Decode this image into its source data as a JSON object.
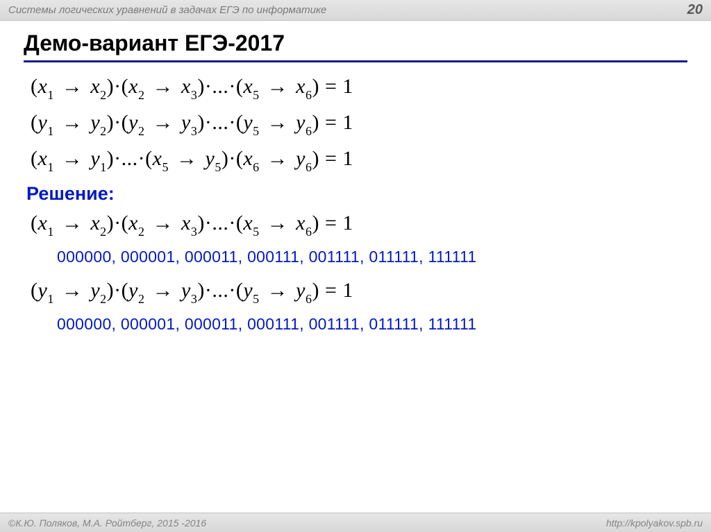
{
  "header": {
    "title": "Системы логических уравнений в задачах ЕГЭ по информатике",
    "page": "20"
  },
  "slide": {
    "title": "Демо-вариант ЕГЭ-2017"
  },
  "equations": {
    "eq1": {
      "t1v": "x",
      "t1s": "1",
      "t2v": "x",
      "t2s": "2",
      "t3v": "x",
      "t3s": "2",
      "t4v": "x",
      "t4s": "3",
      "t5v": "x",
      "t5s": "5",
      "t6v": "x",
      "t6s": "6",
      "dots": "...",
      "eq": " = 1"
    },
    "eq2": {
      "t1v": "y",
      "t1s": "1",
      "t2v": "y",
      "t2s": "2",
      "t3v": "y",
      "t3s": "2",
      "t4v": "y",
      "t4s": "3",
      "t5v": "y",
      "t5s": "5",
      "t6v": "y",
      "t6s": "6",
      "dots": "...",
      "eq": " = 1"
    },
    "eq3": {
      "t1v": "x",
      "t1s": "1",
      "t2v": "y",
      "t2s": "1",
      "t3v": "x",
      "t3s": "5",
      "t4v": "y",
      "t4s": "5",
      "t5v": "x",
      "t5s": "6",
      "t6v": "y",
      "t6s": "6",
      "dots": "...",
      "eq": " = 1"
    }
  },
  "solution": {
    "label": "Решение:",
    "sol_eq1": {
      "t1v": "x",
      "t1s": "1",
      "t2v": "x",
      "t2s": "2",
      "t3v": "x",
      "t3s": "2",
      "t4v": "x",
      "t4s": "3",
      "t5v": "x",
      "t5s": "5",
      "t6v": "x",
      "t6s": "6",
      "dots": "...",
      "eq": " = 1"
    },
    "bin1": "000000, 000001, 000011, 000111, 001111, 011111, 111111",
    "sol_eq2": {
      "t1v": "y",
      "t1s": "1",
      "t2v": "y",
      "t2s": "2",
      "t3v": "y",
      "t3s": "2",
      "t4v": "y",
      "t4s": "3",
      "t5v": "y",
      "t5s": "5",
      "t6v": "y",
      "t6s": "6",
      "dots": "...",
      "eq": " = 1"
    },
    "bin2": "000000, 000001, 000011, 000111, 001111, 011111, 111111"
  },
  "footer": {
    "copyright": "К.Ю. Поляков, М.А. Ройтберг, 2015 -2016",
    "url": "http://kpolyakov.spb.ru"
  },
  "glyph": {
    "arrow": "→",
    "dot": "·",
    "lp": "(",
    "rp": ")",
    "copy": "©"
  }
}
